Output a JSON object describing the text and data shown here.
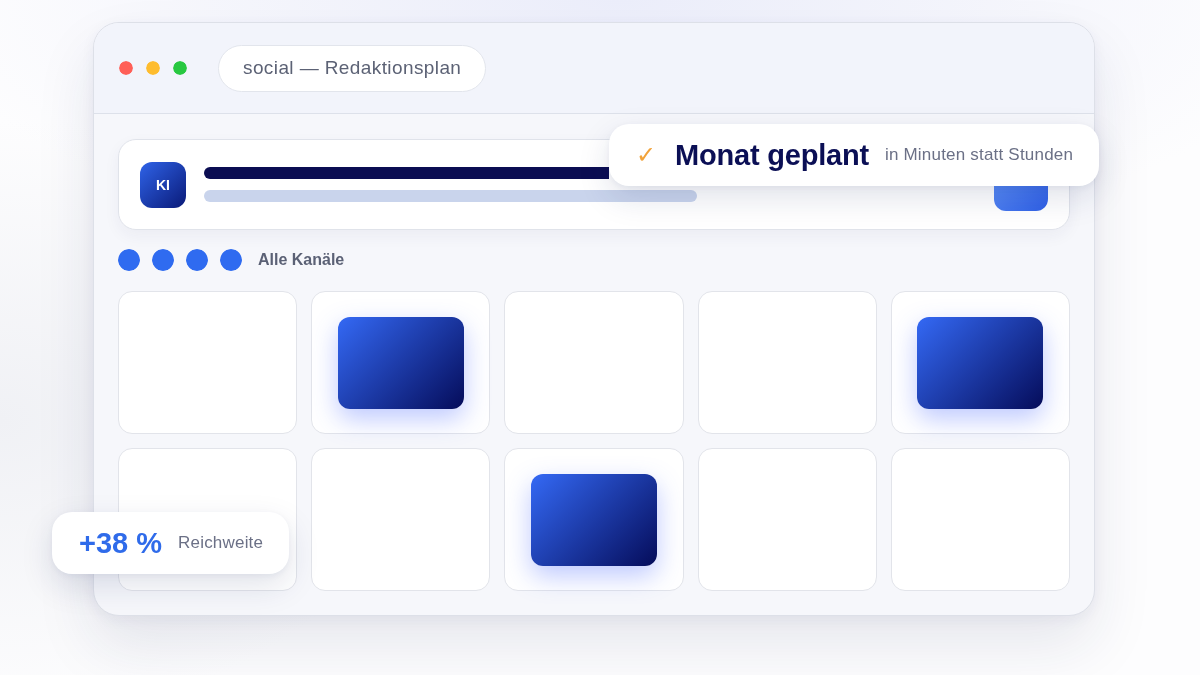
{
  "window": {
    "title": "social — Redaktionsplan",
    "traffic_lights": [
      {
        "color": "#ff5f57"
      },
      {
        "color": "#febc2e"
      },
      {
        "color": "#28c840"
      }
    ]
  },
  "assistant_bar": {
    "avatar": "KI"
  },
  "channels": {
    "dots": [
      {
        "color": "#2f6bf0"
      },
      {
        "color": "#2f6bf0"
      },
      {
        "color": "#2f6bf0"
      },
      {
        "color": "#2f6bf0"
      }
    ],
    "label": "Alle Kanäle"
  },
  "calendar": {
    "cells": [
      {
        "has_post": false
      },
      {
        "has_post": true
      },
      {
        "has_post": false
      },
      {
        "has_post": false
      },
      {
        "has_post": true
      },
      {
        "has_post": false
      },
      {
        "has_post": false
      },
      {
        "has_post": true
      },
      {
        "has_post": false
      },
      {
        "has_post": false
      }
    ]
  },
  "badges": [
    {
      "kind": "check",
      "icon": "✓",
      "title": "Monat geplant",
      "caption": "in Minuten statt Stunden"
    },
    {
      "kind": "metric",
      "value": "+38 %",
      "caption": "Reichweite"
    }
  ]
}
